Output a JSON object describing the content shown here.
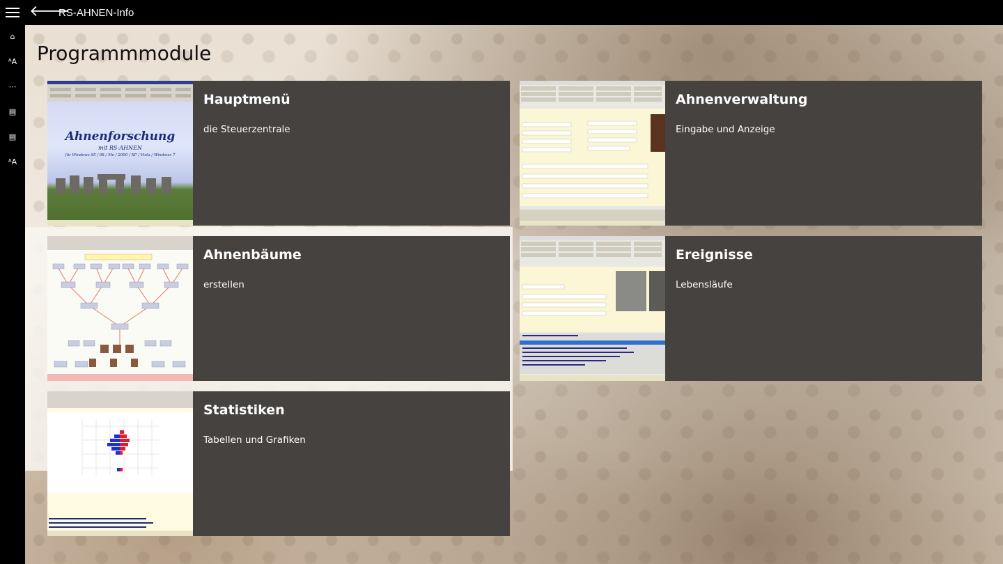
{
  "app": {
    "title": "RS-AHNEN-Info"
  },
  "rail": {
    "items": [
      {
        "glyph": "⌂"
      },
      {
        "glyph": "ᴬA"
      },
      {
        "glyph": "⋯"
      },
      {
        "glyph": "▤"
      },
      {
        "glyph": "▤"
      },
      {
        "glyph": "ᴬA"
      }
    ]
  },
  "page": {
    "title": "Programmmodule"
  },
  "tiles": [
    {
      "title": "Hauptmenü",
      "subtitle": "die Steuerzentrale",
      "thumb": "main-menu-screenshot"
    },
    {
      "title": "Ahnenverwaltung",
      "subtitle": "Eingabe und Anzeige",
      "thumb": "ancestor-admin-screenshot"
    },
    {
      "title": "Ahnenbäume",
      "subtitle": "erstellen",
      "thumb": "family-tree-screenshot"
    },
    {
      "title": "Ereignisse",
      "subtitle": "Lebensläufe",
      "thumb": "events-screenshot"
    },
    {
      "title": "Statistiken",
      "subtitle": "Tabellen und Grafiken",
      "thumb": "statistics-screenshot"
    }
  ],
  "thumb_texts": {
    "haupt_title": "Ahnenforschung",
    "haupt_sub": "mit RS-AHNEN",
    "haupt_os": "für Windows 95 / 98 / Me / 2000 / XP / Vista / Windows 7"
  },
  "colors": {
    "tile_bg": "#454240",
    "titlebar_bg": "#000000"
  }
}
